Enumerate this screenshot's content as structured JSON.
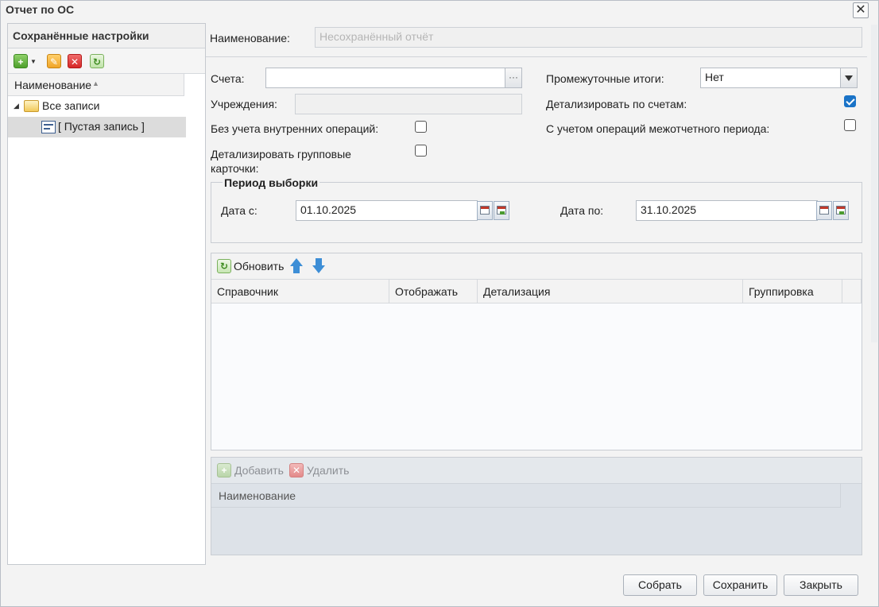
{
  "window": {
    "title": "Отчет по ОС",
    "close_icon": "close-icon"
  },
  "left_panel": {
    "header": "Сохранённые настройки",
    "toolbar_icons": [
      "add-icon",
      "edit-icon",
      "delete-icon",
      "refresh-icon"
    ],
    "column_header": "Наименование",
    "tree": [
      {
        "label": "Все записи",
        "icon": "folder-icon",
        "expanded": true
      },
      {
        "label": "[ Пустая запись ]",
        "icon": "record-icon",
        "selected": true
      }
    ]
  },
  "form": {
    "name_label": "Наименование:",
    "name_placeholder": "Несохранённый отчёт",
    "accounts_label": "Счета:",
    "accounts_value": "",
    "institutions_label": "Учреждения:",
    "institutions_value": "",
    "no_internal_ops_label": "Без учета внутренних операций:",
    "no_internal_ops_checked": false,
    "detail_group_cards_label_line1": "Детализировать групповые",
    "detail_group_cards_label_line2": "карточки:",
    "detail_group_cards_checked": false,
    "subtotals_label": "Промежуточные итоги:",
    "subtotals_value": "Нет",
    "detail_by_accounts_label": "Детализировать по счетам:",
    "detail_by_accounts_checked": true,
    "interperiod_ops_label": "С учетом операций межотчетного периода:",
    "interperiod_ops_checked": false,
    "ellipsis": "···"
  },
  "period": {
    "legend": "Период выборки",
    "date_from_label": "Дата с:",
    "date_from_value": "01.10.2025",
    "date_to_label": "Дата по:",
    "date_to_value": "31.10.2025"
  },
  "grid1": {
    "refresh_label": "Обновить",
    "columns": [
      "Справочник",
      "Отображать",
      "Детализация",
      "Группировка"
    ],
    "rows": []
  },
  "grid2": {
    "add_label": "Добавить",
    "delete_label": "Удалить",
    "columns": [
      "Наименование"
    ],
    "rows": []
  },
  "buttons": {
    "build": "Собрать",
    "save": "Сохранить",
    "close": "Закрыть"
  },
  "colors": {
    "checkbox_checked": "#1a73c7",
    "arrow_blue": "#3d8ed6"
  }
}
